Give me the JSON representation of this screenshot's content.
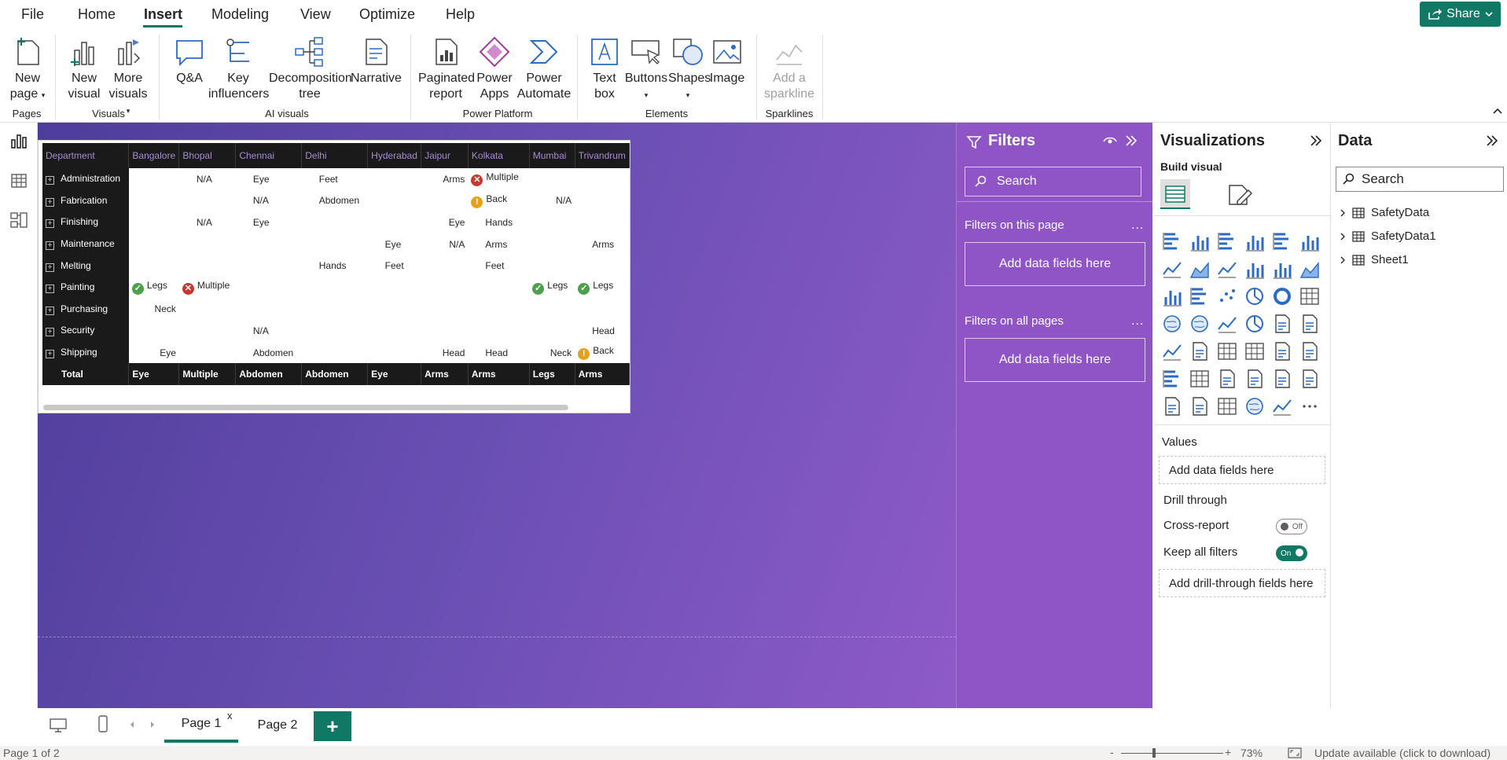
{
  "menu": {
    "items": [
      "File",
      "Home",
      "Insert",
      "Modeling",
      "View",
      "Optimize",
      "Help"
    ],
    "share_label": "Share"
  },
  "ribbon": {
    "buttons": {
      "new_page": "New page",
      "new_visual": "New visual",
      "more_visuals": "More visuals",
      "qa": "Q&A",
      "key_influencers": "Key influencers",
      "decomposition_tree": "Decomposition tree",
      "narrative": "Narrative",
      "paginated_report": "Paginated report",
      "power_apps": "Power Apps",
      "power_automate": "Power Automate",
      "text_box": "Text box",
      "buttons": "Buttons",
      "shapes": "Shapes",
      "image": "Image",
      "add_sparkline": "Add a sparkline"
    },
    "groups": {
      "pages": "Pages",
      "visuals": "Visuals",
      "ai_visuals": "AI visuals",
      "power_platform": "Power Platform",
      "elements": "Elements",
      "sparklines": "Sparklines"
    }
  },
  "matrix": {
    "columns": [
      "Department",
      "Bangalore",
      "Bhopal",
      "Chennai",
      "Delhi",
      "Hyderabad",
      "Jaipur",
      "Kolkata",
      "Mumbai",
      "Trivandrum"
    ],
    "rows": [
      {
        "name": "Administration",
        "cells": [
          "",
          "N/A",
          "Eye",
          "Feet",
          "",
          "Arms",
          "x|Multiple",
          "",
          ""
        ]
      },
      {
        "name": "Fabrication",
        "cells": [
          "",
          "",
          "N/A",
          "Abdomen",
          "",
          "",
          "!|Back",
          "N/A",
          ""
        ]
      },
      {
        "name": "Finishing",
        "cells": [
          "",
          "N/A",
          "Eye",
          "",
          "",
          "Eye",
          "Hands",
          "",
          ""
        ]
      },
      {
        "name": "Maintenance",
        "cells": [
          "",
          "",
          "",
          "",
          "Eye",
          "N/A",
          "Arms",
          "",
          "Arms"
        ]
      },
      {
        "name": "Melting",
        "cells": [
          "",
          "",
          "",
          "Hands",
          "Feet",
          "",
          "Feet",
          "",
          ""
        ]
      },
      {
        "name": "Painting",
        "cells": [
          "v|Legs",
          "x|Multiple",
          "",
          "",
          "",
          "",
          "",
          "v|Legs",
          "v|Legs"
        ]
      },
      {
        "name": "Purchasing",
        "cells": [
          "Neck",
          "",
          "",
          "",
          "",
          "",
          "",
          "",
          ""
        ]
      },
      {
        "name": "Security",
        "cells": [
          "",
          "",
          "N/A",
          "",
          "",
          "",
          "",
          "",
          "Head"
        ]
      },
      {
        "name": "Shipping",
        "cells": [
          "Eye",
          "",
          "Abdomen",
          "",
          "",
          "Head",
          "Head",
          "Neck",
          "!|Back"
        ]
      }
    ],
    "total": {
      "name": "Total",
      "cells": [
        "Eye",
        "Multiple",
        "Abdomen",
        "Abdomen",
        "Eye",
        "Arms",
        "Arms",
        "Legs",
        "Arms"
      ]
    }
  },
  "filters": {
    "title": "Filters",
    "search_placeholder": "Search",
    "on_this_page": "Filters on this page",
    "on_all_pages": "Filters on all pages",
    "add_fields": "Add data fields here",
    "more": "..."
  },
  "visualizations": {
    "title": "Visualizations",
    "build_visual": "Build visual",
    "values_label": "Values",
    "values_well": "Add data fields here",
    "drill_through": "Drill through",
    "cross_report": "Cross-report",
    "cross_report_state": "Off",
    "keep_all_filters": "Keep all filters",
    "keep_all_filters_state": "On",
    "drill_well": "Add drill-through fields here"
  },
  "data_pane": {
    "title": "Data",
    "search_placeholder": "Search",
    "tables": [
      "SafetyData",
      "SafetyData1",
      "Sheet1"
    ]
  },
  "pages": {
    "tabs": [
      "Page 1",
      "Page 2"
    ],
    "active": "Page 1",
    "close_glyph": "x",
    "add_glyph": "+"
  },
  "status": {
    "page_info": "Page 1 of 2",
    "zoom": "73%",
    "update": "Update available (click to download)"
  },
  "colors": {
    "accent": "#117865",
    "canvas_start": "#4e3d9a",
    "canvas_end": "#8e5ac8",
    "filters_bg": "#8f55c6",
    "header_bg": "#1a1a1a",
    "header_text": "#a78bd6"
  }
}
